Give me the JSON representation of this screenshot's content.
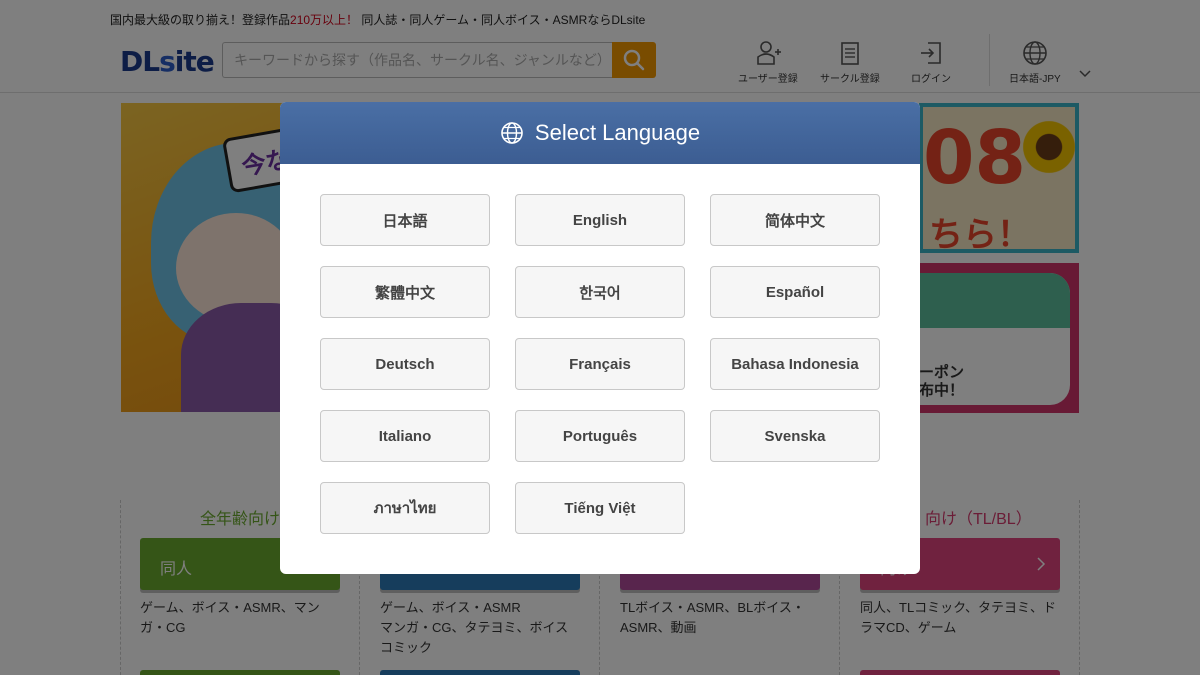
{
  "header": {
    "tagline_prefix": "国内最大級の取り揃え！登録作品",
    "tagline_count": "210万以上！",
    "tagline_suffix": " 同人誌・同人ゲーム・同人ボイス・ASMRならDLsite",
    "logo_main": "DL",
    "logo_slash": "s",
    "logo_rest": "ite",
    "search_placeholder": "キーワードから探す（作品名、サークル名、ジャンルなど）",
    "nav": [
      {
        "label": "ユーザー登録",
        "icon": "user-add-icon"
      },
      {
        "label": "サークル登録",
        "icon": "circle-register-icon"
      },
      {
        "label": "ログイン",
        "icon": "login-icon"
      },
      {
        "label": "日本語-JPY",
        "icon": "globe-icon"
      }
    ]
  },
  "banners": {
    "left_bubble": "今な",
    "right_top_big": "08",
    "right_top_small": "ちら！",
    "right_bottom_line1": "ーポン",
    "right_bottom_line2": "布中！"
  },
  "categories": [
    {
      "heading": "全年齢向け",
      "button": "同人",
      "desc": "ゲーム、ボイス・ASMR、マンガ・CG",
      "color": "#6aab2e",
      "head_color": "#6aab2e"
    },
    {
      "heading": "",
      "button": "",
      "desc": "ゲーム、ボイス・ASMR\nマンガ・CG、タテヨミ、ボイスコミック",
      "color": "#2d7bb8",
      "head_color": "#2d7bb8"
    },
    {
      "heading": "",
      "button": "",
      "desc": "TLボイス・ASMR、BLボイス・ASMR、動画",
      "color": "#b04a9a",
      "head_color": "#b04a9a"
    },
    {
      "heading": "向け（TL/BL）",
      "button": "向け",
      "desc": "同人、TLコミック、タテヨミ、ドラマCD、ゲーム",
      "color": "#e0457f",
      "head_color": "#d63a6e"
    }
  ],
  "modal": {
    "title": "Select Language",
    "languages": [
      "日本語",
      "English",
      "简体中文",
      "繁體中文",
      "한국어",
      "Español",
      "Deutsch",
      "Français",
      "Bahasa Indonesia",
      "Italiano",
      "Português",
      "Svenska",
      "ภาษาไทย",
      "Tiếng Việt"
    ]
  }
}
